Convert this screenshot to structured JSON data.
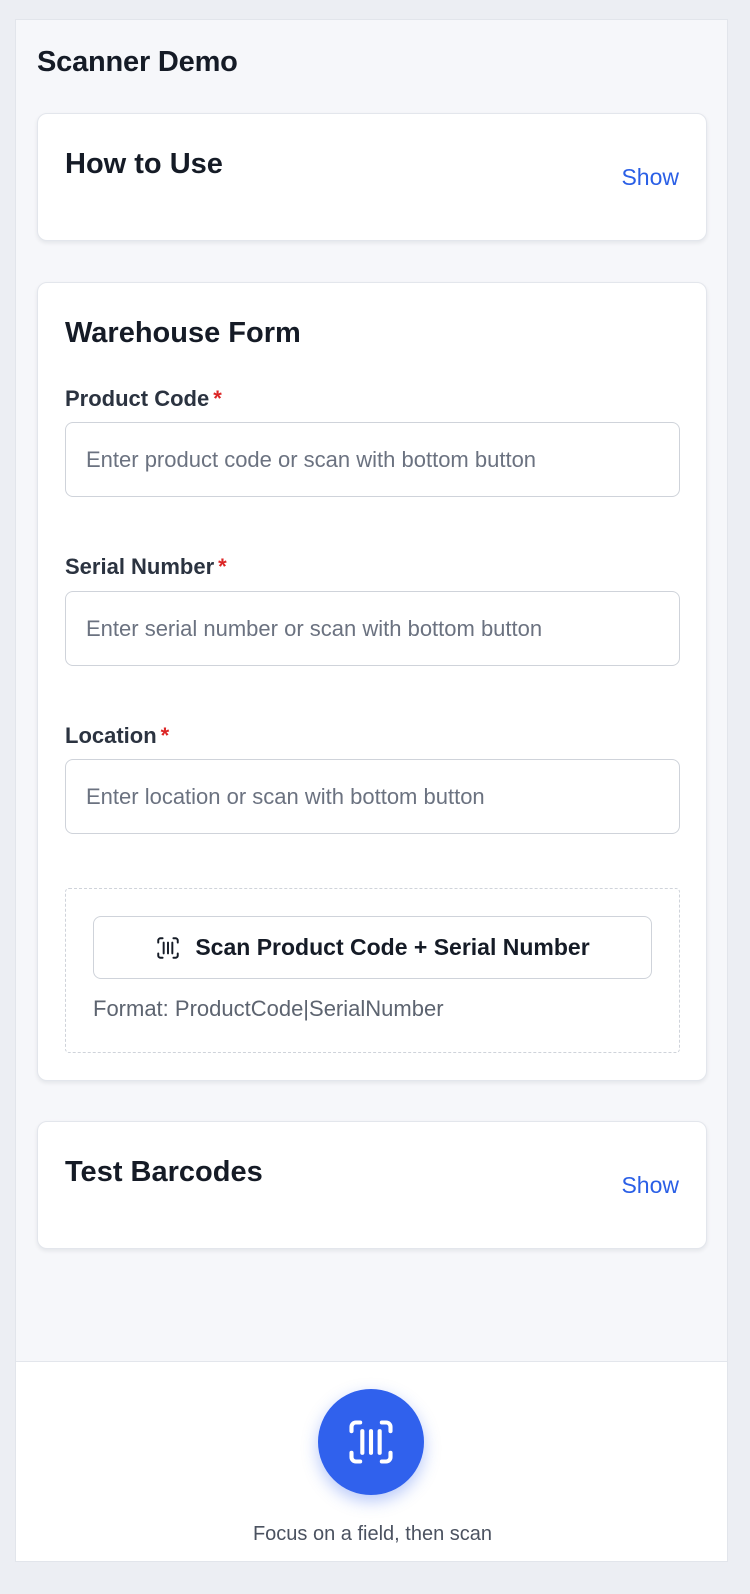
{
  "app": {
    "title": "Scanner Demo"
  },
  "how_to_use": {
    "title": "How to Use",
    "toggle_label": "Show"
  },
  "warehouse_form": {
    "title": "Warehouse Form",
    "required_marker": "*",
    "fields": [
      {
        "label": "Product Code",
        "placeholder": "Enter product code or scan with bottom button",
        "value": ""
      },
      {
        "label": "Serial Number",
        "placeholder": "Enter serial number or scan with bottom button",
        "value": ""
      },
      {
        "label": "Location",
        "placeholder": "Enter location or scan with bottom button",
        "value": ""
      }
    ],
    "combo_scan": {
      "button_label": "Scan Product Code + Serial Number",
      "icon": "barcode-scan-icon",
      "format_note": "Format: ProductCode|SerialNumber"
    }
  },
  "test_barcodes": {
    "title": "Test Barcodes",
    "toggle_label": "Show"
  },
  "bottom_bar": {
    "scan_button_icon": "barcode-scan-icon",
    "hint": "Focus on a field, then scan"
  },
  "colors": {
    "accent": "#3061ed",
    "link": "#2a5fe6",
    "required": "#dc2626",
    "background": "#f6f7fa"
  }
}
